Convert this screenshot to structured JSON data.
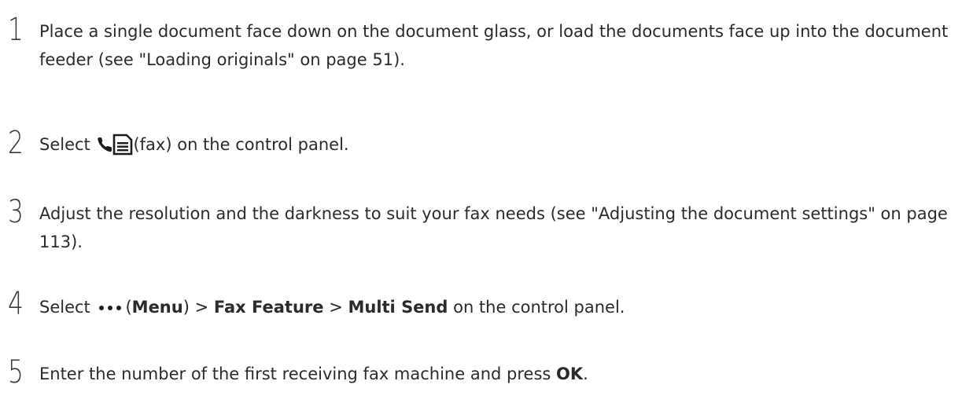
{
  "steps": [
    {
      "number": "1",
      "text": "Place a single document face down on the document glass, or load the documents face up into the document feeder (see \"Loading originals\" on page 51)."
    },
    {
      "number": "2",
      "pre": "Select ",
      "icon": "fax-icon",
      "post": "(fax) on the control panel."
    },
    {
      "number": "3",
      "text": "Adjust the resolution and the darkness to suit your fax needs (see \"Adjusting the document settings\" on page 113)."
    },
    {
      "number": "4",
      "pre": "Select ",
      "icon": "menu-dots-icon",
      "open_paren": "(",
      "menu": "Menu",
      "close_paren": ")",
      "sep1": " > ",
      "fax_feature": "Fax Feature",
      "sep2": " > ",
      "multi_send": "Multi Send",
      "post": " on the control panel."
    },
    {
      "number": "5",
      "pre": "Enter the number of the first receiving fax machine and press ",
      "ok": "OK",
      "post": "."
    }
  ]
}
